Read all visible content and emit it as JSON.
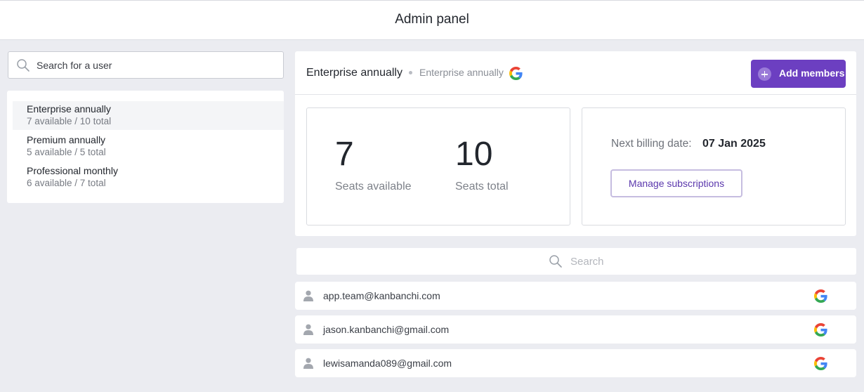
{
  "header": {
    "title": "Admin panel"
  },
  "user_search": {
    "placeholder": "Search for a user"
  },
  "plans": [
    {
      "name": "Enterprise annually",
      "availability": "7 available / 10 total",
      "active": true
    },
    {
      "name": "Premium annually",
      "availability": "5 available / 5 total",
      "active": false
    },
    {
      "name": "Professional monthly",
      "availability": "6 available / 7 total",
      "active": false
    }
  ],
  "panel": {
    "title": "Enterprise annually",
    "subtitle": "Enterprise annually",
    "provider_icon": "google-icon",
    "add_members_label": "Add members",
    "seats_available_value": "7",
    "seats_available_label": "Seats available",
    "seats_total_value": "10",
    "seats_total_label": "Seats total",
    "billing_label": "Next billing date:",
    "billing_date": "07 Jan 2025",
    "manage_label": "Manage subscriptions"
  },
  "member_search": {
    "placeholder": "Search"
  },
  "members": [
    {
      "email": "app.team@kanbanchi.com",
      "provider_icon": "google-icon"
    },
    {
      "email": "jason.kanbanchi@gmail.com",
      "provider_icon": "google-icon"
    },
    {
      "email": "lewisamanda089@gmail.com",
      "provider_icon": "google-icon"
    }
  ],
  "colors": {
    "accent": "#6c3fc1",
    "background": "#ebecf1",
    "google_blue": "#4285F4",
    "google_red": "#EA4335",
    "google_yellow": "#FBBC05",
    "google_green": "#34A853"
  }
}
